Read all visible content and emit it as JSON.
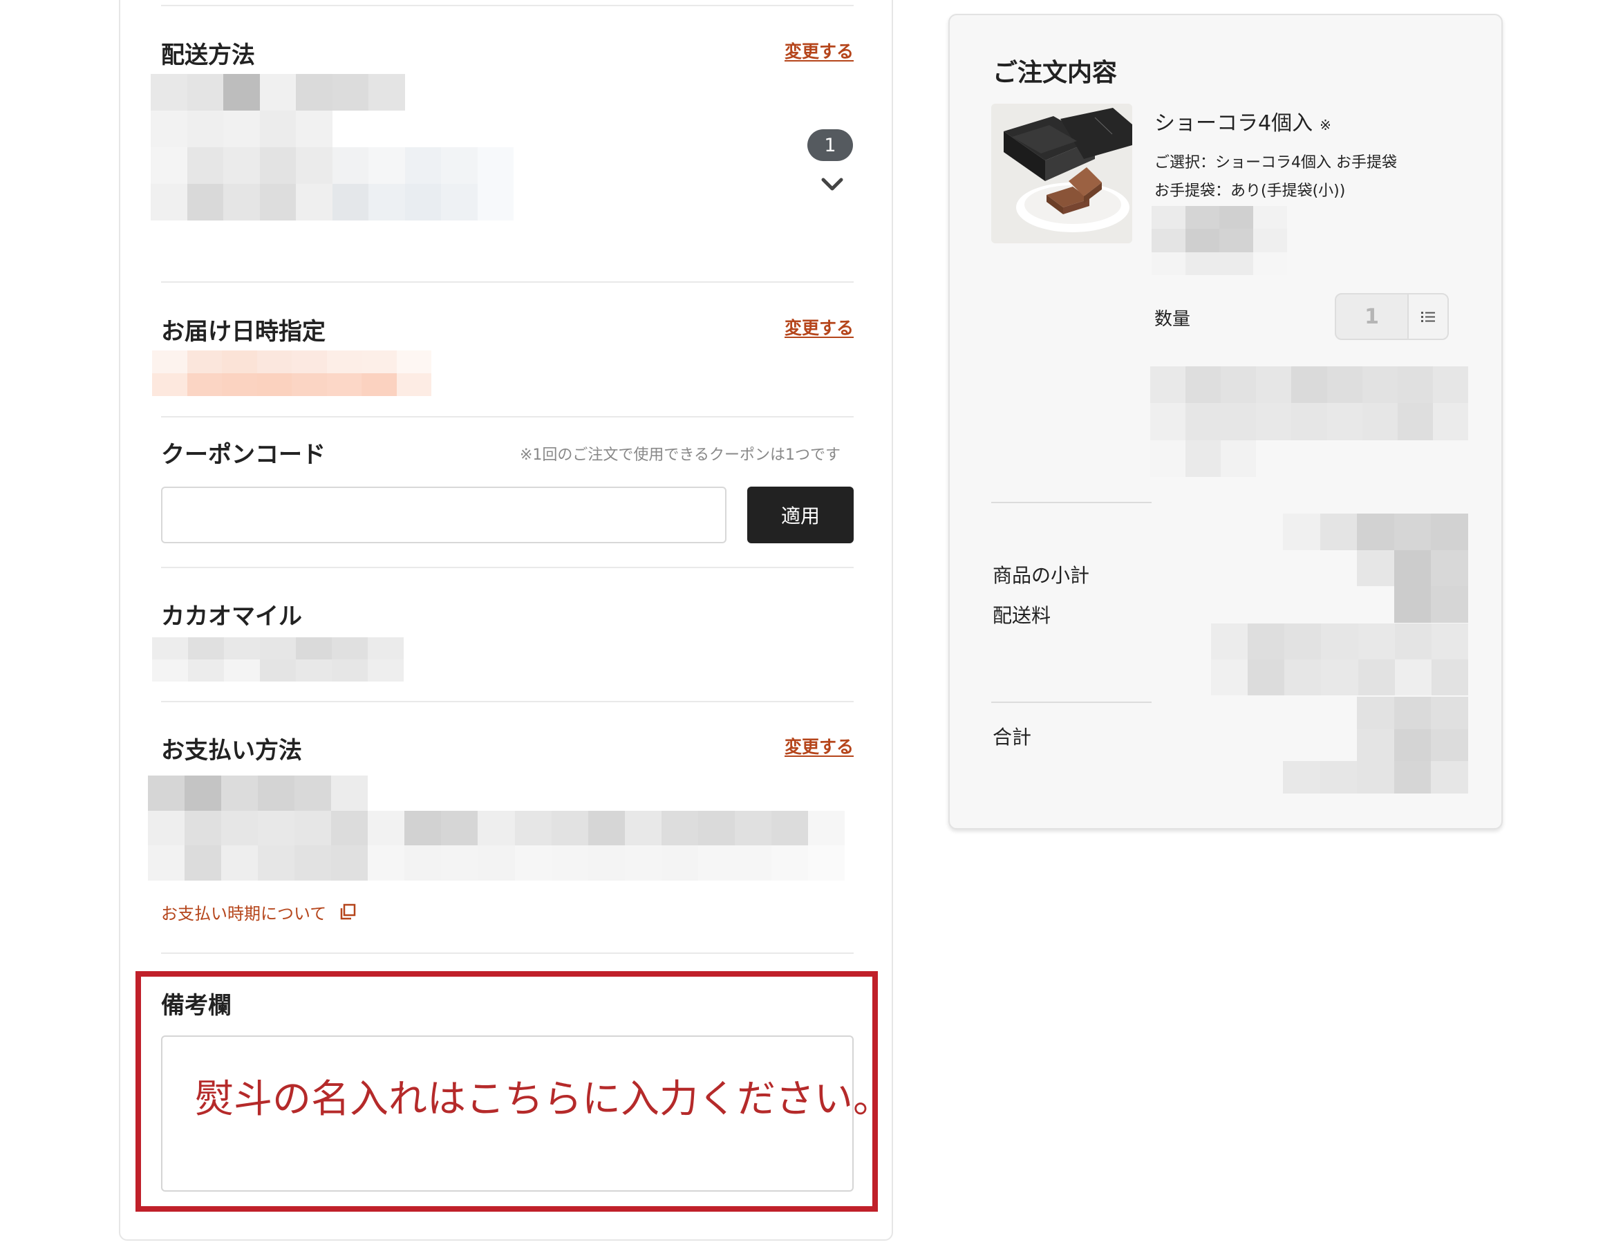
{
  "checkout": {
    "delivery_method": {
      "title": "配送方法",
      "change_label": "変更する",
      "item_count": "1"
    },
    "delivery_datetime": {
      "title": "お届け日時指定",
      "change_label": "変更する"
    },
    "coupon": {
      "title": "クーポンコード",
      "note": "※1回のご注文で使用できるクーポンは1つです",
      "input_value": "",
      "input_placeholder": "",
      "apply_label": "適用"
    },
    "cacao_mile": {
      "title": "カカオマイル"
    },
    "payment": {
      "title": "お支払い方法",
      "change_label": "変更する",
      "timing_link": "お支払い時期について"
    },
    "remarks": {
      "title": "備考欄",
      "annotation": "熨斗の名入れはこちらに入力ください。"
    }
  },
  "order_summary": {
    "title": "ご注文内容",
    "product": {
      "name": "ショーコラ4個入",
      "name_note": "※",
      "selection": "ご選択：ショーコラ4個入 お手提袋",
      "bag": "お手提袋：あり(手提袋(小))"
    },
    "quantity_label": "数量",
    "quantity_value": "1",
    "subtotal_label": "商品の小計",
    "shipping_label": "配送料",
    "total_label": "合計"
  },
  "colors": {
    "accent_link": "#b5451b",
    "highlight_border": "#c0202a",
    "annotation_text": "#b52a2a",
    "apply_button_bg": "#222222",
    "summary_bg": "#f7f7f7"
  },
  "icons": {
    "delivery_toggle": "chevron-down-icon",
    "payment_timing_link": "external-window-icon",
    "quantity_menu": "list-icon"
  }
}
